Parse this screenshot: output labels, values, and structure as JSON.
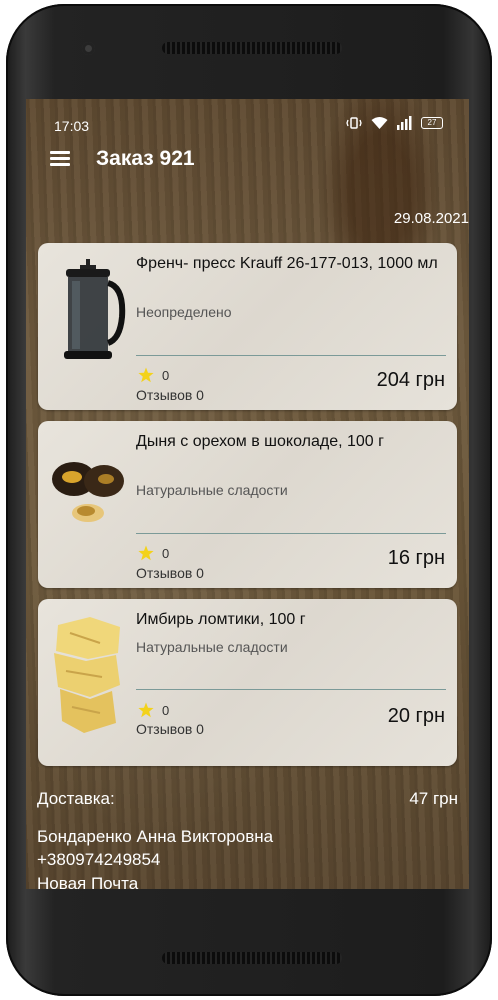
{
  "status_bar": {
    "time": "17:03",
    "battery": "27",
    "icons": [
      "vibrate-icon",
      "wifi-icon",
      "signal-icon",
      "battery-icon"
    ]
  },
  "toolbar": {
    "title": "Заказ 921",
    "menu_icon": "hamburger-menu-icon"
  },
  "order": {
    "date": "29.08.2021",
    "items": [
      {
        "name": "Френч- пресс Krauff 26-177-013, 1000 мл",
        "category": "Неопределено",
        "rating": "0",
        "reviews": "Отзывов 0",
        "price": "204 грн"
      },
      {
        "name": "Дыня с орехом в шоколаде, 100 г",
        "category": "Натуральные сладости",
        "rating": "0",
        "reviews": "Отзывов 0",
        "price": "16 грн"
      },
      {
        "name": "Имбирь ломтики, 100 г",
        "category": "Натуральные сладости",
        "rating": "0",
        "reviews": "Отзывов 0",
        "price": "20 грн"
      }
    ]
  },
  "delivery": {
    "label": "Доставка:",
    "price": "47 грн",
    "recipient": "Бондаренко Анна Викторовна",
    "phone": "+380974249854",
    "service": "Новая Почта"
  },
  "colors": {
    "star": "#f3d21b",
    "divider": "#7b9a98",
    "card": "#e4e0d8"
  }
}
